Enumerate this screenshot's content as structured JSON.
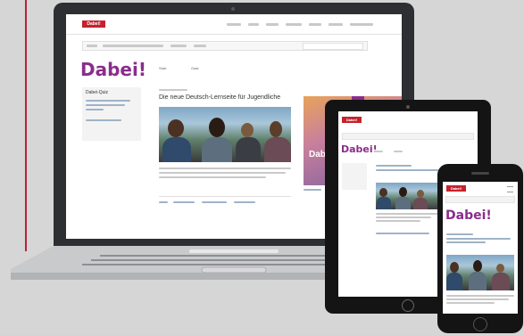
{
  "laptop": {
    "logo": "Dabei!",
    "site_title": "Dabei!",
    "tabs": [
      "Start",
      "Gast"
    ],
    "sidebar_title": "Dabei-Quiz",
    "article_heading": "Die neue Deutsch-Lernseite für Jugendliche",
    "teaser_label": "Dabei"
  },
  "tablet": {
    "logo": "Dabei!",
    "site_title": "Dabei!"
  },
  "phone": {
    "logo": "Dabei!",
    "site_title": "Dabei!"
  },
  "colors": {
    "brand_red": "#c4222c",
    "title_purple": "#8a2d8b",
    "background": "#d6d6d6"
  }
}
